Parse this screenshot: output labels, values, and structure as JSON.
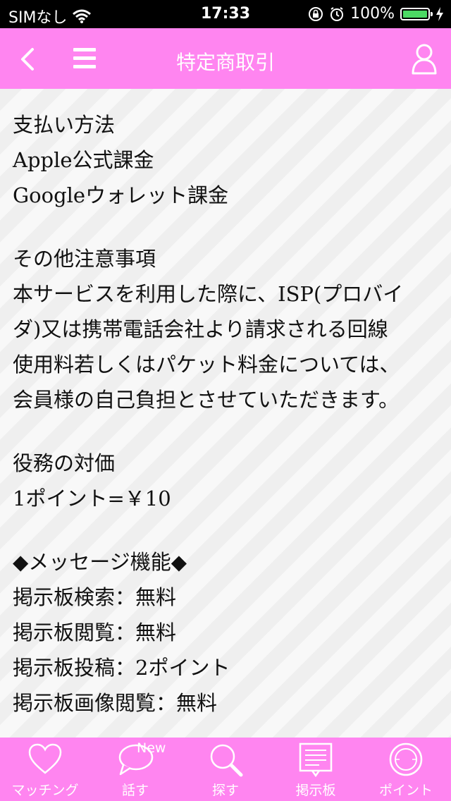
{
  "status_bar": {
    "carrier": "SIMなし",
    "time": "17:33",
    "battery": "100%",
    "battery_color": "#4cd964"
  },
  "nav": {
    "title": "特定商取引",
    "back_icon": "chevron-left-icon",
    "menu_icon": "hamburger-icon",
    "user_icon": "user-icon",
    "color": "#ff85f0"
  },
  "content": {
    "payment": {
      "heading": "支払い方法",
      "items": [
        "Apple公式課金",
        "Googleウォレット課金"
      ]
    },
    "notes": {
      "heading": "その他注意事項",
      "lines": [
        "本サービスを利用した際に、ISP(プロバイ",
        "ダ)又は携帯電話会社より請求される回線",
        "使用料若しくはパケット料金については、",
        "会員様の自己負担とさせていただきます。"
      ]
    },
    "price": {
      "heading": "役務の対価",
      "value": "1ポイント=￥10"
    },
    "message": {
      "heading": "◆メッセージ機能◆",
      "items": [
        "掲示板検索：無料",
        "掲示板閲覧：無料",
        "掲示板投稿：2ポイント",
        "掲示板画像閲覧：無料"
      ]
    }
  },
  "tabs": [
    {
      "label": "マッチング",
      "icon": "heart-icon"
    },
    {
      "label": "話す",
      "icon": "chat-bubble-icon",
      "badge": "New"
    },
    {
      "label": "探す",
      "icon": "search-icon"
    },
    {
      "label": "掲示板",
      "icon": "bulletin-board-icon"
    },
    {
      "label": "ポイント",
      "icon": "coin-icon"
    }
  ]
}
